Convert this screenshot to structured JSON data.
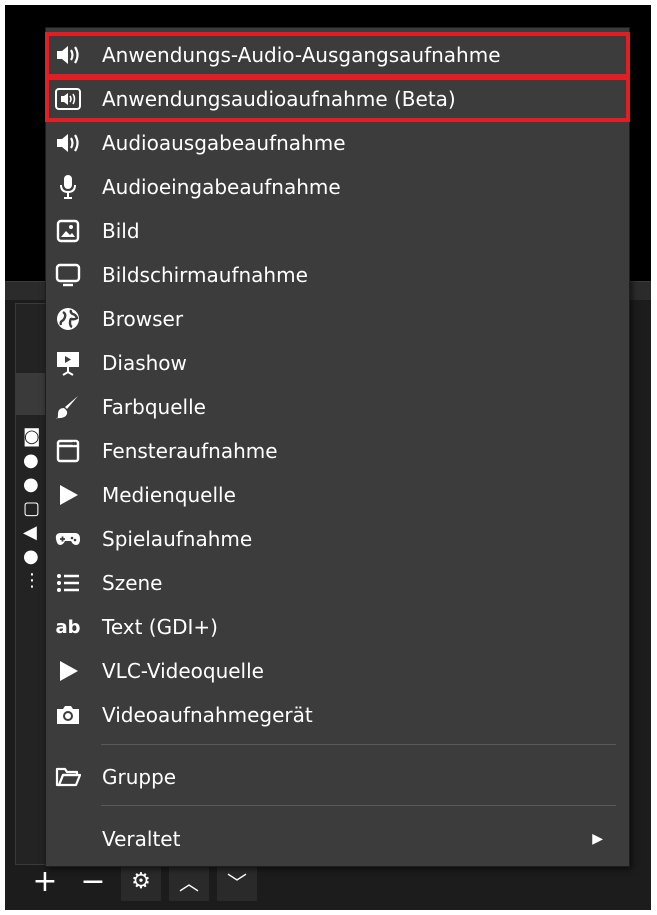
{
  "menu": {
    "items": [
      {
        "label": "Anwendungs-Audio-Ausgangsaufnahme",
        "icon": "speaker-icon"
      },
      {
        "label": "Anwendungsaudioaufnahme (Beta)",
        "icon": "app-audio-icon"
      },
      {
        "label": "Audioausgabeaufnahme",
        "icon": "speaker-icon"
      },
      {
        "label": "Audioeingabeaufnahme",
        "icon": "microphone-icon"
      },
      {
        "label": "Bild",
        "icon": "image-icon"
      },
      {
        "label": "Bildschirmaufnahme",
        "icon": "monitor-icon"
      },
      {
        "label": "Browser",
        "icon": "globe-icon"
      },
      {
        "label": "Diashow",
        "icon": "slideshow-icon"
      },
      {
        "label": "Farbquelle",
        "icon": "brush-icon"
      },
      {
        "label": "Fensteraufnahme",
        "icon": "window-icon"
      },
      {
        "label": "Medienquelle",
        "icon": "play-icon"
      },
      {
        "label": "Spielaufnahme",
        "icon": "gamepad-icon"
      },
      {
        "label": "Szene",
        "icon": "list-icon"
      },
      {
        "label": "Text (GDI+)",
        "icon": "text-icon"
      },
      {
        "label": "VLC-Videoquelle",
        "icon": "play-icon"
      },
      {
        "label": "Videoaufnahmegerät",
        "icon": "camera-icon"
      }
    ],
    "group": {
      "label": "Gruppe",
      "icon": "folder-icon"
    },
    "deprecated": {
      "label": "Veraltet",
      "icon": "chevron-right-icon"
    }
  },
  "highlight_color": "#e21e25"
}
